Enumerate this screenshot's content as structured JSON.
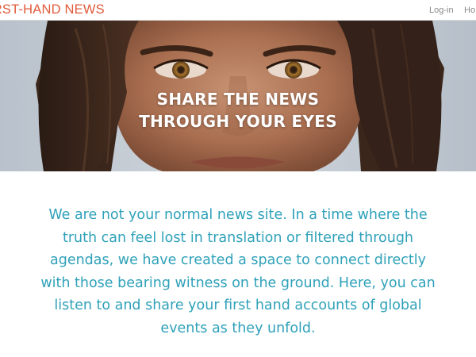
{
  "header": {
    "logo": "IRST-HAND NEWS",
    "nav": [
      {
        "label": "Log-in"
      },
      {
        "label": "Ho"
      }
    ]
  },
  "hero": {
    "title_lines": [
      "SHARE THE NEWS",
      "THROUGH YOUR EYES"
    ]
  },
  "mission": {
    "lines": [
      "We are not your normal news site. In a time where the",
      "truth can feel lost in translation or filtered through",
      "agendas, we have created a space to connect directly",
      "with those bearing witness on the ground. Here, you can",
      "listen to and share your first hand accounts of global",
      "events as they unfold."
    ]
  },
  "colors": {
    "logo": "#e15a3b",
    "mission_text": "#2fa1b9",
    "nav_text": "#8a8a8a"
  }
}
